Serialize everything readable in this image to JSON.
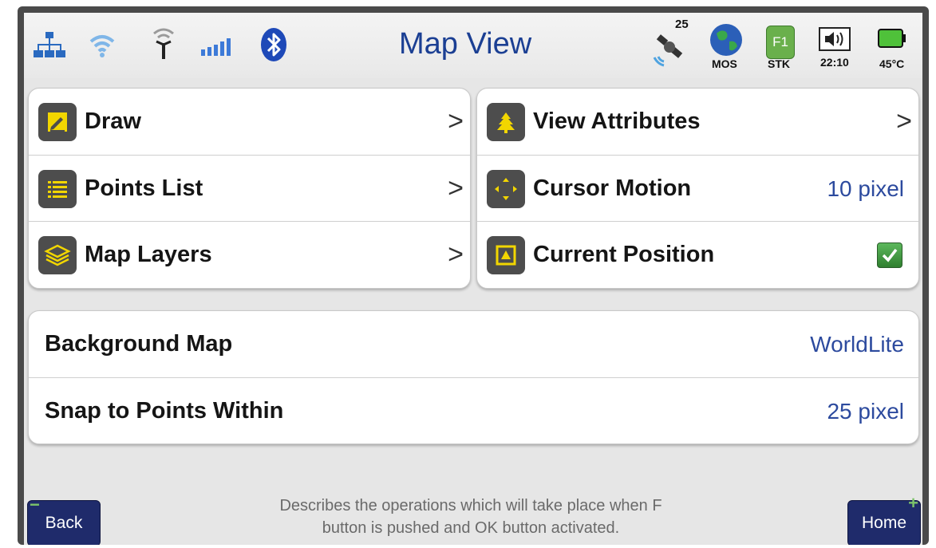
{
  "status_bar": {
    "title": "Map View",
    "satellite_count": "25",
    "mode_label": "MOS",
    "function_key": "F1",
    "function_key_label": "STK",
    "time": "22:10",
    "temperature": "45°C",
    "icons": [
      "network-icon",
      "wifi-icon",
      "antenna-icon",
      "signal-strength-icon",
      "bluetooth-icon",
      "satellite-icon",
      "globe-icon",
      "function-key-icon",
      "speaker-icon",
      "battery-icon"
    ]
  },
  "left_menu": [
    {
      "label": "Draw",
      "icon": "pencil-icon",
      "indicator": ">"
    },
    {
      "label": "Points List",
      "icon": "list-icon",
      "indicator": ">"
    },
    {
      "label": "Map Layers",
      "icon": "layers-icon",
      "indicator": ">"
    }
  ],
  "right_menu": {
    "view_attributes": {
      "label": "View Attributes",
      "icon": "tree-icon",
      "indicator": ">"
    },
    "cursor_motion": {
      "label": "Cursor Motion",
      "icon": "move-arrows-icon",
      "value": "10 pixel"
    },
    "current_position": {
      "label": "Current Position",
      "icon": "position-icon",
      "checked": true
    }
  },
  "settings": {
    "background_map": {
      "label": "Background Map",
      "value": "WorldLite"
    },
    "snap_points": {
      "label": "Snap to Points Within",
      "value": "25 pixel"
    }
  },
  "footer": {
    "help_line1": "Describes the operations which will take place when F",
    "help_line2": "button is pushed and OK button activated.",
    "back_label": "Back",
    "back_mark": "−",
    "home_label": "Home",
    "home_mark": "+"
  },
  "colors": {
    "accent_blue": "#1b3f93",
    "value_blue": "#2c4a9e",
    "softkey_navy": "#1f2b6b",
    "icon_tile": "#4d4d4d",
    "icon_yellow": "#f2d600",
    "check_green": "#3c9a3c"
  }
}
